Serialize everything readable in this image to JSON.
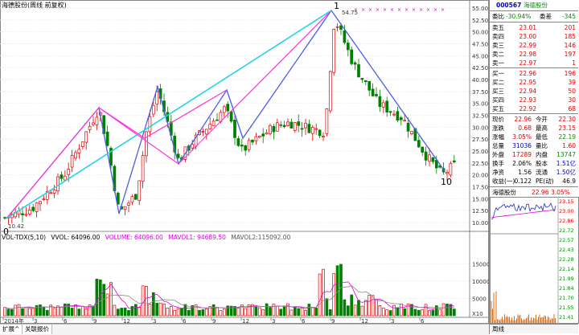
{
  "chart": {
    "title": "海德股份(周线 前复权)",
    "price_axis_labels": [
      "55.00",
      "52.50",
      "50.00",
      "47.50",
      "45.00",
      "42.50",
      "40.00",
      "37.50",
      "35.00",
      "32.50",
      "30.00",
      "27.50",
      "25.00",
      "22.50",
      "20.00",
      "17.50",
      "15.00",
      "12.50",
      "10.00"
    ],
    "wave_labels": [
      "1",
      "0",
      "10"
    ],
    "high_marker": "54.75",
    "low_marker": "10.42",
    "vol_header": {
      "name": "VOL-TDX(5,10)",
      "vvol": "VVOL: 64096.00",
      "volume": "VOLUME: 64096.00",
      "mavol1": "MAVOL1: 94689.50",
      "mavol2": "MAVOL2:115092.00"
    },
    "vol_axis_labels": [
      "15000",
      "10000",
      "5000"
    ],
    "vol_axis_unit": "X10",
    "date_labels": [
      "2014年",
      "3",
      "6",
      "9",
      "12",
      "3",
      "6",
      "9",
      "12",
      "3",
      "6",
      "9",
      "12",
      "3",
      "6"
    ],
    "tabs": [
      "扩展^",
      "关联报价"
    ]
  },
  "quote": {
    "code": "000567",
    "name": "海德股份",
    "weibi_label": "委比",
    "weibi": "-30.94%",
    "weicha_label": "委差",
    "weicha": "-345",
    "sells": [
      {
        "label": "卖五",
        "price": "23.01",
        "vol": "201"
      },
      {
        "label": "卖四",
        "price": "23.00",
        "vol": "185"
      },
      {
        "label": "卖三",
        "price": "22.99",
        "vol": "146"
      },
      {
        "label": "卖二",
        "price": "22.98",
        "vol": "197"
      },
      {
        "label": "卖一",
        "price": "22.97",
        "vol": "1"
      }
    ],
    "buys": [
      {
        "label": "买一",
        "price": "22.96",
        "vol": "196"
      },
      {
        "label": "买二",
        "price": "22.95",
        "vol": "39"
      },
      {
        "label": "买三",
        "price": "22.94",
        "vol": "50"
      },
      {
        "label": "买四",
        "price": "22.93",
        "vol": "30"
      },
      {
        "label": "买五",
        "price": "22.92",
        "vol": "68"
      }
    ],
    "stats": [
      {
        "l1": "现价",
        "v1": "22.96",
        "l2": "今开",
        "v2": "22.30"
      },
      {
        "l1": "涨跌",
        "v1": "0.68",
        "l2": "最高",
        "v2": "23.15"
      },
      {
        "l1": "涨幅",
        "v1": "3.05%",
        "l2": "最低",
        "v2": "22.19"
      },
      {
        "l1": "总量",
        "v1": "31036",
        "l2": "量比",
        "v2": "1.60"
      },
      {
        "l1": "外盘",
        "v1": "17289",
        "l2": "内盘",
        "v2": "13747"
      },
      {
        "l1": "换手",
        "v1": "2.06%",
        "l2": "股本",
        "v2": "1.51亿"
      },
      {
        "l1": "净资",
        "v1": "1.56",
        "l2": "流通",
        "v2": "1.50亿"
      },
      {
        "l1": "收益(一)",
        "v1": "0.122",
        "l2": "PE(动)",
        "v2": "46.9"
      }
    ],
    "mini_chart": {
      "name": "海德股份",
      "price": "22.96",
      "pct": "3.05%",
      "axis_labels": [
        "23.15",
        "23.00",
        "22.86",
        "22.72",
        "22.57",
        "22.43",
        "22.28",
        "22.14",
        "21.99",
        "21.84",
        "21.70",
        "21.55",
        "21.41"
      ]
    },
    "bottom_label": "周线"
  }
}
